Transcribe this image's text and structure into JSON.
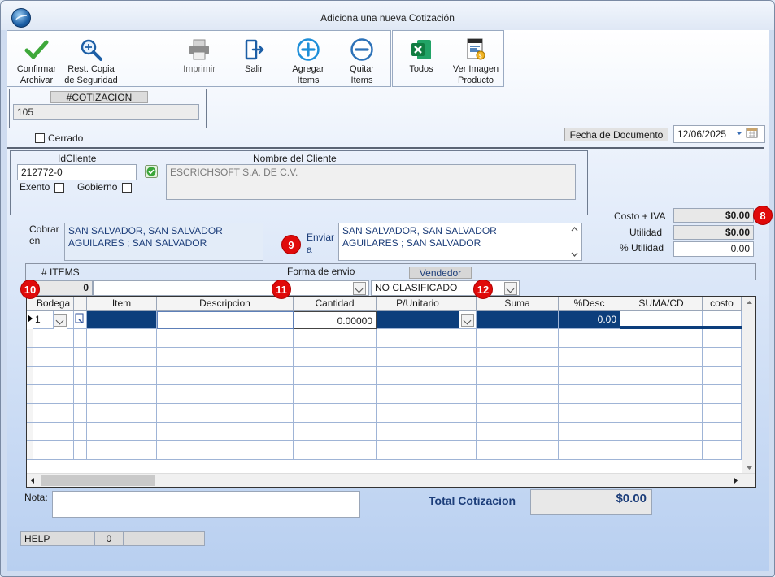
{
  "window": {
    "title": "Adiciona una nueva Cotización"
  },
  "toolbar": {
    "confirm_label": "Confirmar\nArchivar",
    "restore_label": "Rest. Copia\nde Seguridad",
    "print_label": "Imprimir",
    "exit_label": "Salir",
    "add_label": "Agregar\nItems",
    "remove_label": "Quitar\nItems",
    "all_label": "Todos",
    "image_label": "Ver Imagen\nProducto"
  },
  "cotizacion": {
    "header": "#COTIZACION",
    "value": "105",
    "closed_label": "Cerrado"
  },
  "fecha": {
    "label": "Fecha de  Documento",
    "value": "12/06/2025"
  },
  "cliente": {
    "id_label": "IdCliente",
    "id_value": "212772-0",
    "name_label": "Nombre del Cliente",
    "name_value": "ESCRICHSOFT S.A. DE C.V.",
    "exento_label": "Exento",
    "gobierno_label": "Gobierno"
  },
  "cobrar": {
    "label": "Cobrar\nen",
    "value": "SAN SALVADOR, SAN SALVADOR\nAGUILARES ; SAN SALVADOR"
  },
  "enviar": {
    "label": "Enviar\na",
    "value": "SAN SALVADOR, SAN SALVADOR\nAGUILARES ; SAN SALVADOR"
  },
  "totals": {
    "costo_label": "Costo + IVA",
    "costo_value": "$0.00",
    "utilidad_label": "Utilidad",
    "utilidad_value": "$0.00",
    "pct_label": "% Utilidad",
    "pct_value": "0.00"
  },
  "order": {
    "items_label": "# ITEMS",
    "items_value": "0",
    "envio_label": "Forma de envio",
    "envio_value": "",
    "vendedor_label": "Vendedor",
    "vendedor_value": "NO CLASIFICADO"
  },
  "markers": {
    "m8": "8",
    "m9": "9",
    "m10": "10",
    "m11": "11",
    "m12": "12"
  },
  "grid": {
    "columns": [
      "Bodega",
      "",
      "Item",
      "Descripcion",
      "Cantidad",
      "P/Unitario",
      "",
      "Suma",
      "%Desc",
      "SUMA/CD",
      "costo"
    ],
    "row1": {
      "bodega": "1",
      "cantidad": "0.00000",
      "desc_pct": "0.00"
    }
  },
  "nota": {
    "label": "Nota:",
    "value": ""
  },
  "total": {
    "label": "Total Cotizacion",
    "value": "$0.00"
  },
  "status": {
    "help": "HELP",
    "count": "0",
    "extra": ""
  },
  "colors": {
    "selected_row": "#0c3e7c",
    "accent": "#e00a0a"
  }
}
